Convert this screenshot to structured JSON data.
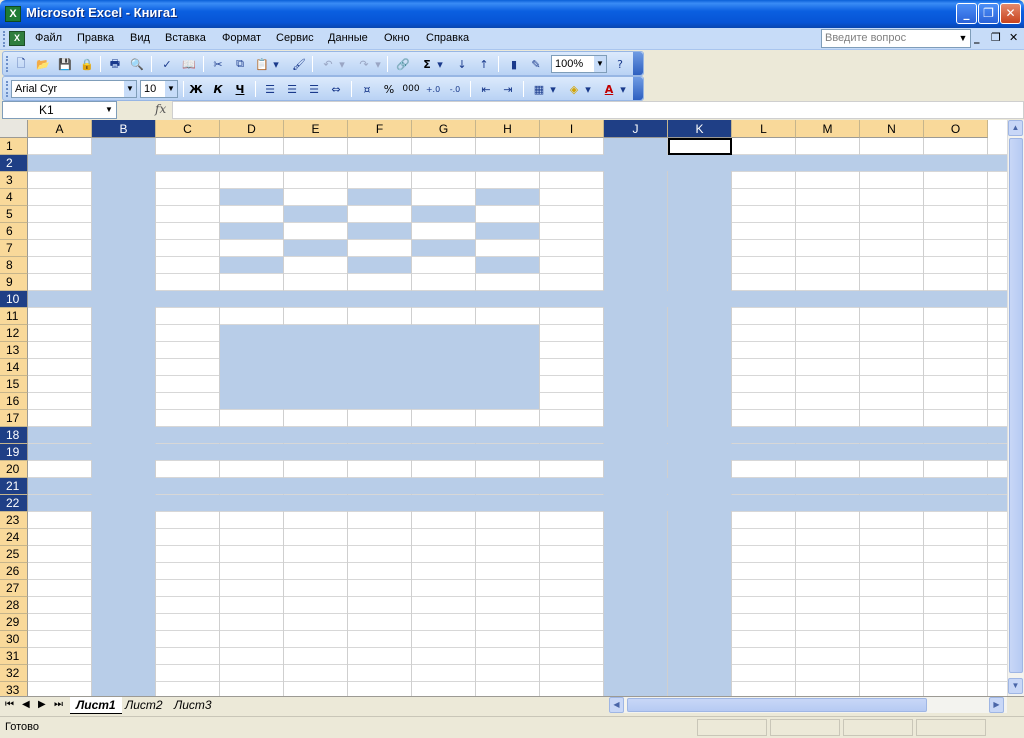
{
  "window": {
    "title": "Microsoft Excel - Книга1"
  },
  "menu": {
    "items": [
      "Файл",
      "Правка",
      "Вид",
      "Вставка",
      "Формат",
      "Сервис",
      "Данные",
      "Окно",
      "Справка"
    ],
    "ask_placeholder": "Введите вопрос"
  },
  "toolbar": {
    "zoom": "100%",
    "font_name": "Arial Cyr",
    "font_size": "10",
    "bold_label": "Ж",
    "italic_label": "К",
    "underline_label": "Ч",
    "percent_label": "%",
    "thousands_label": "000"
  },
  "formula_bar": {
    "name_box": "K1",
    "fx_label": "fx",
    "value": ""
  },
  "grid": {
    "columns": [
      "A",
      "B",
      "C",
      "D",
      "E",
      "F",
      "G",
      "H",
      "I",
      "J",
      "K",
      "L",
      "M",
      "N",
      "O"
    ],
    "rows": [
      "1",
      "2",
      "3",
      "4",
      "5",
      "6",
      "7",
      "8",
      "9",
      "10",
      "11",
      "12",
      "13",
      "14",
      "15",
      "16",
      "17",
      "18",
      "19",
      "20",
      "21",
      "22",
      "23",
      "24",
      "25",
      "26",
      "27",
      "28",
      "29",
      "30",
      "31",
      "32",
      "33"
    ],
    "selected_columns": [
      "B",
      "J",
      "K"
    ],
    "selected_rows": [
      "2",
      "10",
      "18",
      "19",
      "21",
      "22"
    ],
    "active_cell": "K1",
    "highlight_color": "#b8cde8"
  },
  "sheets": {
    "tabs": [
      "Лист1",
      "Лист2",
      "Лист3"
    ],
    "active": "Лист1"
  },
  "status": {
    "text": "Готово"
  }
}
